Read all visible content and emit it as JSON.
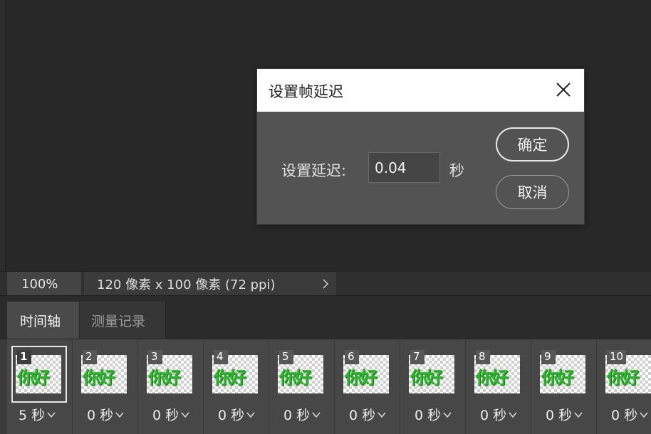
{
  "dialog": {
    "title": "设置帧延迟",
    "delay_label": "设置延迟:",
    "delay_value": "0.04",
    "unit": "秒",
    "ok_label": "确定",
    "cancel_label": "取消"
  },
  "status": {
    "zoom": "100%",
    "doc_info": "120 像素 x 100 像素 (72 ppi)"
  },
  "tabs": [
    {
      "label": "时间轴",
      "active": true
    },
    {
      "label": "测量记录",
      "active": false
    }
  ],
  "frames": [
    {
      "num": "1",
      "delay": "5 秒",
      "thumb_text": "你好",
      "selected": true
    },
    {
      "num": "2",
      "delay": "0 秒",
      "thumb_text": "你好"
    },
    {
      "num": "3",
      "delay": "0 秒",
      "thumb_text": "你好"
    },
    {
      "num": "4",
      "delay": "0 秒",
      "thumb_text": "你好"
    },
    {
      "num": "5",
      "delay": "0 秒",
      "thumb_text": "你好"
    },
    {
      "num": "6",
      "delay": "0 秒",
      "thumb_text": "你好"
    },
    {
      "num": "7",
      "delay": "0 秒",
      "thumb_text": "你好"
    },
    {
      "num": "8",
      "delay": "0 秒",
      "thumb_text": "你好"
    },
    {
      "num": "9",
      "delay": "0 秒",
      "thumb_text": "你好"
    },
    {
      "num": "10",
      "delay": "0 秒",
      "thumb_text": "你好"
    }
  ],
  "colors": {
    "thumb_text": "#2db52d",
    "panel_bg": "#474747",
    "dialog_bg": "#535353"
  }
}
